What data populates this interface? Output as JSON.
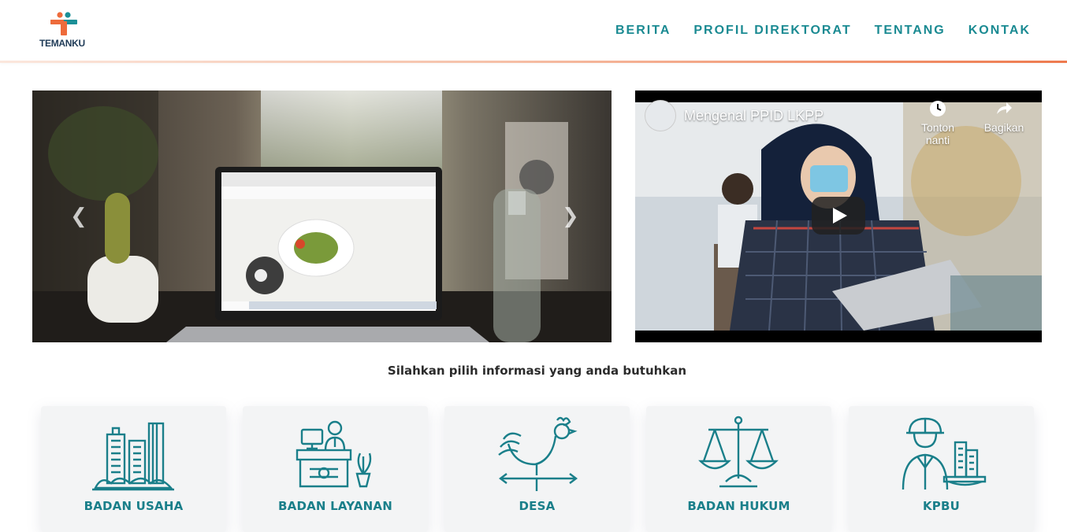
{
  "brand": {
    "name": "TEMANKU"
  },
  "nav": {
    "items": [
      "BERITA",
      "PROFIL DIREKTORAT",
      "TENTANG",
      "KONTAK"
    ]
  },
  "carousel": {
    "prev_icon": "chevron-left-icon",
    "next_icon": "chevron-right-icon",
    "prev_glyph": "❮",
    "next_glyph": "❯"
  },
  "video": {
    "title": "Mengenal PPID LKPP",
    "watch_later": "Tonton nanti",
    "share": "Bagikan"
  },
  "prompt": "Silahkan pilih informasi yang anda butuhkan",
  "categories": [
    {
      "label": "BADAN USAHA",
      "icon": "buildings-icon"
    },
    {
      "label": "BADAN LAYANAN",
      "icon": "service-desk-icon"
    },
    {
      "label": "DESA",
      "icon": "rooster-weathervane-icon"
    },
    {
      "label": "BADAN HUKUM",
      "icon": "scales-of-justice-icon"
    },
    {
      "label": "KPBU",
      "icon": "engineer-city-icon"
    }
  ],
  "colors": {
    "accent": "#1a8a92",
    "logo_orange": "#ee6b3b",
    "logo_teal": "#1b8f97",
    "header_gradient_end": "#ee7a4e"
  }
}
